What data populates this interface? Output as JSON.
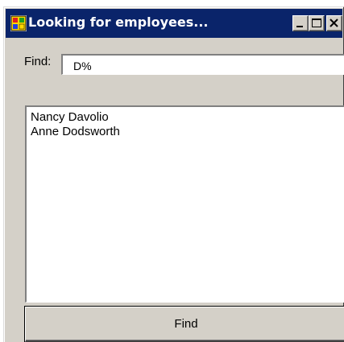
{
  "window": {
    "title": "Looking for employees...",
    "app_icon": "windows-app-icon",
    "controls": {
      "minimize_icon": "minimize-icon",
      "maximize_icon": "maximize-icon",
      "close_icon": "close-icon"
    }
  },
  "search": {
    "label": "Find:",
    "value": "D%"
  },
  "results": {
    "items": [
      {
        "name": "Nancy Davolio"
      },
      {
        "name": "Anne Dodsworth"
      }
    ]
  },
  "actions": {
    "find_label": "Find"
  },
  "colors": {
    "titlebar": "#0a246a",
    "window_face": "#d4d0c8",
    "field_background": "#ffffff"
  }
}
